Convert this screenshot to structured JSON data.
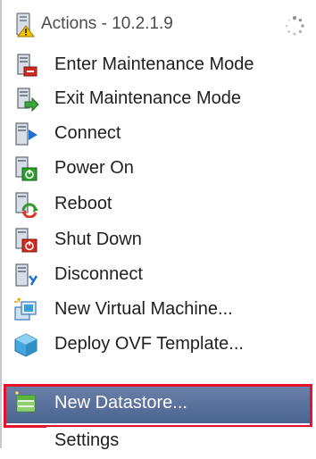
{
  "header": {
    "title": "Actions - 10.2.1.9",
    "icon": "host-warning-icon",
    "busy_indicator": "spinner-icon"
  },
  "menu": {
    "items": [
      {
        "label": "Enter Maintenance Mode",
        "icon": "enter-maintenance-mode-icon"
      },
      {
        "label": "Exit Maintenance Mode",
        "icon": "exit-maintenance-mode-icon"
      },
      {
        "label": "Connect",
        "icon": "connect-host-icon"
      },
      {
        "label": "Power On",
        "icon": "power-on-icon"
      },
      {
        "label": "Reboot",
        "icon": "reboot-icon"
      },
      {
        "label": "Shut Down",
        "icon": "shut-down-icon"
      },
      {
        "label": "Disconnect",
        "icon": "disconnect-host-icon"
      },
      {
        "label": "New Virtual Machine...",
        "icon": "new-virtual-machine-icon"
      },
      {
        "label": "Deploy OVF Template...",
        "icon": "deploy-ovf-template-icon"
      },
      {
        "label": "New Datastore...",
        "icon": "new-datastore-icon",
        "selected": true
      },
      {
        "label": "Settings"
      }
    ]
  },
  "colors": {
    "selection_background": "#5a72a0",
    "selection_highlight_border": "#e2132a",
    "text": "#1f1f1f",
    "header_text": "#4b4b4b"
  }
}
